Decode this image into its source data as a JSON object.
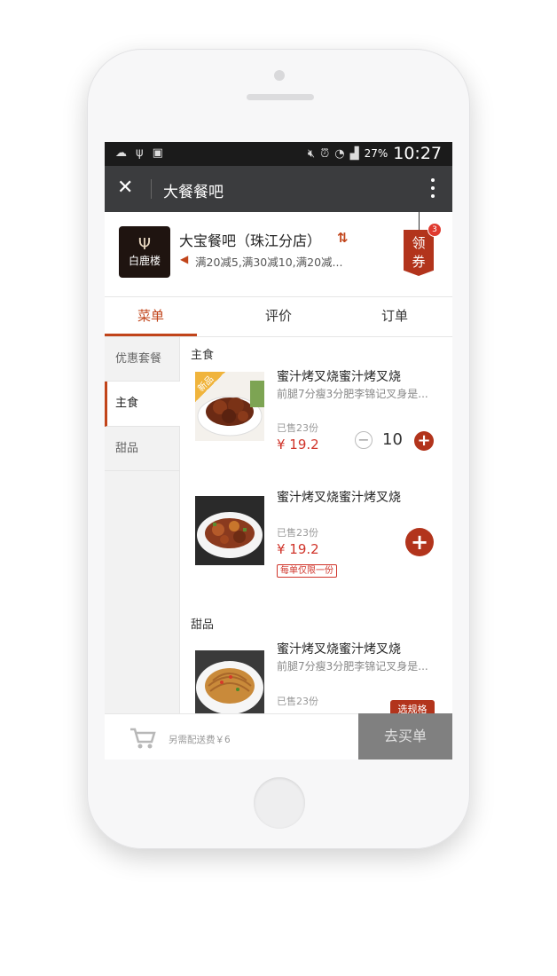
{
  "status_bar": {
    "battery": "27%",
    "time": "10:27"
  },
  "titlebar": {
    "title": "大餐餐吧"
  },
  "shop": {
    "name": "大宝餐吧（珠江分店）",
    "logo_text": "白鹿楼",
    "promo": "满20减5,满30减10,满20减...",
    "coupon_label": "领券",
    "coupon_count": "3"
  },
  "tabs": [
    {
      "label": "菜单"
    },
    {
      "label": "评价"
    },
    {
      "label": "订单"
    }
  ],
  "categories": [
    {
      "label": "优惠套餐"
    },
    {
      "label": "主食"
    },
    {
      "label": "甜品"
    }
  ],
  "sections": [
    {
      "title": "主食",
      "items": [
        {
          "name": "蜜汁烤叉烧蜜汁烤叉烧",
          "desc": "前腿7分瘦3分肥李锦记叉身是...",
          "sold": "已售23份",
          "price": "¥ 19.2",
          "qty": "10",
          "badge": "新品"
        },
        {
          "name": "蜜汁烤叉烧蜜汁烤叉烧",
          "sold": "已售23份",
          "price": "¥ 19.2",
          "limit": "每单仅限一份"
        }
      ]
    },
    {
      "title": "甜品",
      "items": [
        {
          "name": "蜜汁烤叉烧蜜汁烤叉烧",
          "desc": "前腿7分瘦3分肥李锦记叉身是...",
          "sold": "已售23份",
          "spec_label": "选规格"
        }
      ]
    }
  ],
  "bottom": {
    "delivery": "另需配送费￥6",
    "checkout": "去买单"
  },
  "colors": {
    "accent": "#b2341c",
    "price": "#d0342a",
    "titlebar": "#3b3c3e"
  }
}
